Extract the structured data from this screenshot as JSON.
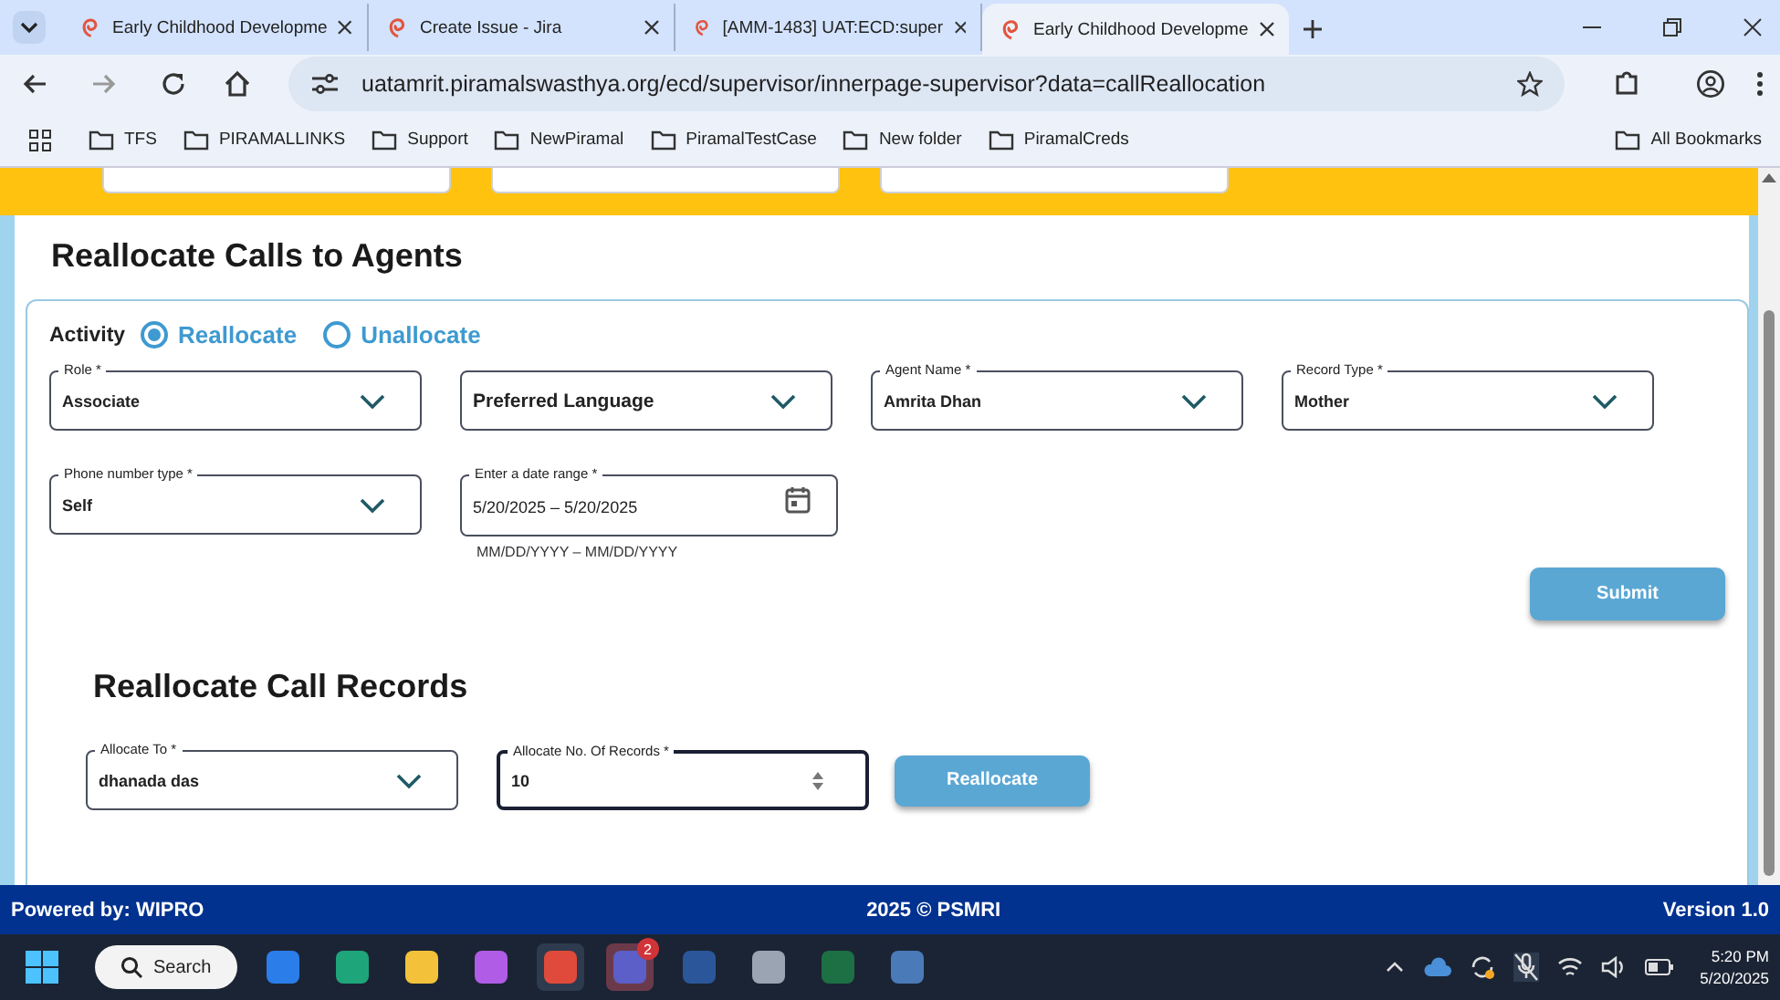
{
  "browser": {
    "tabs": [
      {
        "title": "Early Childhood Developme",
        "selected": false
      },
      {
        "title": "Create Issue - Jira",
        "selected": false
      },
      {
        "title": "[AMM-1483] UAT:ECD:super",
        "selected": false
      },
      {
        "title": "Early Childhood Developme",
        "selected": true
      }
    ],
    "address": "uatamrit.piramalswasthya.org/ecd/supervisor/innerpage-supervisor?data=callReallocation",
    "bookmarks": [
      "TFS",
      "PIRAMALLINKS",
      "Support",
      "NewPiramal",
      "PiramalTestCase",
      "New folder",
      "PiramalCreds"
    ],
    "all_bookmarks": "All Bookmarks"
  },
  "page": {
    "title": "Reallocate Calls to Agents",
    "activity": {
      "label": "Activity",
      "options": [
        {
          "label": "Reallocate",
          "selected": true
        },
        {
          "label": "Unallocate",
          "selected": false
        }
      ]
    },
    "fields": [
      {
        "kind": "select",
        "label": "Role *",
        "value": "Associate"
      },
      {
        "kind": "select",
        "placeholder": "Preferred Language"
      },
      {
        "kind": "select",
        "label": "Agent Name *",
        "value": "Amrita Dhan"
      },
      {
        "kind": "select",
        "label": "Record Type *",
        "value": "Mother"
      },
      {
        "kind": "select",
        "label": "Phone number type *",
        "value": "Self"
      },
      {
        "kind": "daterange",
        "label": "Enter a date range *",
        "value": "5/20/2025 – 5/20/2025",
        "hint": "MM/DD/YYYY – MM/DD/YYYY"
      }
    ],
    "submit": "Submit",
    "section_title": "Reallocate Call Records",
    "allocate_fields": [
      {
        "kind": "select",
        "label": "Allocate To *",
        "value": "dhanada das"
      },
      {
        "kind": "number",
        "label": "Allocate No. Of Records *",
        "value": "10"
      }
    ],
    "reallocate": "Reallocate"
  },
  "footer": {
    "left": "Powered by: WIPRO",
    "center": "2025 © PSMRI",
    "right": "Version 1.0"
  },
  "taskbar": {
    "search": "Search",
    "badge": "2",
    "time": "5:20 PM",
    "date": "5/20/2025"
  }
}
